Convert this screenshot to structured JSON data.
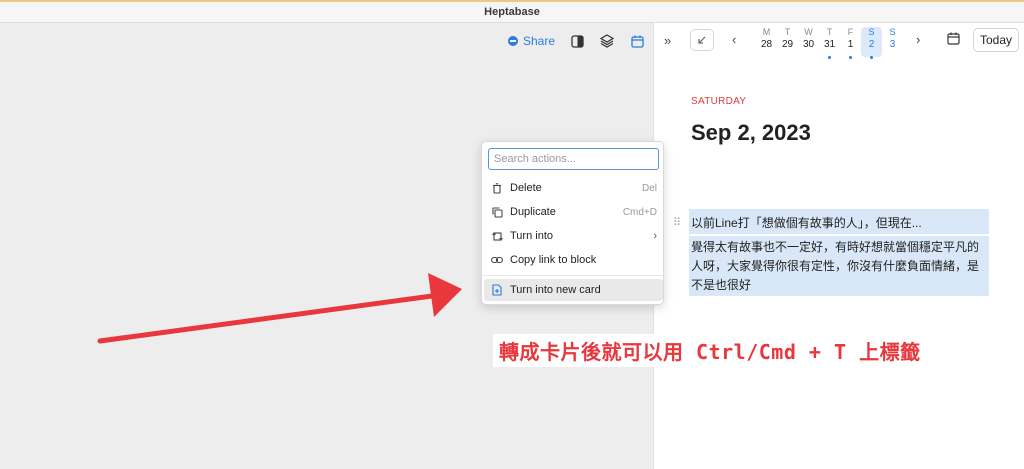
{
  "window": {
    "title": "Heptabase"
  },
  "left_toolbar": {
    "share_label": "Share",
    "icons": [
      "sidebar-toggle-icon",
      "layers-icon",
      "calendar-icon"
    ]
  },
  "calendar_bar": {
    "collapse_icon": "double-chevron-right-icon",
    "corner_icon": "arrow-down-left-icon",
    "prev_icon": "chevron-left-icon",
    "next_icon": "chevron-right-icon",
    "days": [
      {
        "weekday": "M",
        "date": "28",
        "dot": false,
        "selected": false
      },
      {
        "weekday": "T",
        "date": "29",
        "dot": false,
        "selected": false
      },
      {
        "weekday": "W",
        "date": "30",
        "dot": false,
        "selected": false
      },
      {
        "weekday": "T",
        "date": "31",
        "dot": true,
        "selected": false
      },
      {
        "weekday": "F",
        "date": "1",
        "dot": true,
        "selected": false
      },
      {
        "weekday": "S",
        "date": "2",
        "dot": true,
        "selected": true
      },
      {
        "weekday": "S",
        "date": "3",
        "dot": false,
        "selected": false
      }
    ],
    "today_label": "Today"
  },
  "journal": {
    "weekday": "SATURDAY",
    "date": "Sep 2, 2023",
    "blocks": [
      "以前Line打「想做個有故事的人」，但現在...",
      "覺得太有故事也不一定好，有時好想就當個穩定平凡的人呀，大家覺得你很有定性，你沒有什麼負面情緒，是不是也很好"
    ]
  },
  "context_menu": {
    "search_placeholder": "Search actions...",
    "items": [
      {
        "label": "Delete",
        "shortcut": "Del",
        "icon": "trash-icon"
      },
      {
        "label": "Duplicate",
        "shortcut": "Cmd+D",
        "icon": "duplicate-icon"
      },
      {
        "label": "Turn into",
        "shortcut": "",
        "icon": "turn-into-icon"
      },
      {
        "label": "Copy link to block",
        "shortcut": "",
        "icon": "link-icon"
      },
      {
        "label": "Turn into new card",
        "shortcut": "",
        "icon": "new-card-icon"
      }
    ]
  },
  "annotation": {
    "text": "轉成卡片後就可以用 Ctrl/Cmd + T 上標籤",
    "color": "#e8373d"
  },
  "colors": {
    "accent": "#2b7be4",
    "weekday_red": "#e03c3c",
    "block_highlight": "#d8e8f8"
  }
}
